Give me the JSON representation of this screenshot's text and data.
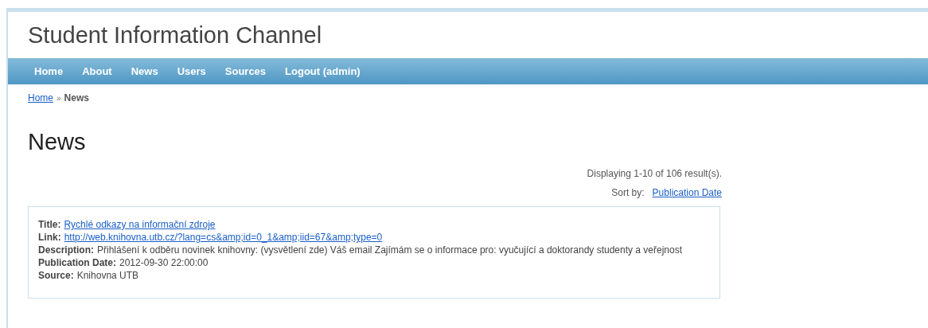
{
  "header": {
    "title": "Student Information Channel"
  },
  "nav": [
    {
      "label": "Home"
    },
    {
      "label": "About"
    },
    {
      "label": "News"
    },
    {
      "label": "Users"
    },
    {
      "label": "Sources"
    },
    {
      "label": "Logout (admin)"
    }
  ],
  "breadcrumb": {
    "link": "Home",
    "separator": "»",
    "current": "News"
  },
  "page_title": "News",
  "summary": "Displaying 1-10 of 106 result(s).",
  "sort": {
    "label": "Sort by:",
    "link": "Publication Date"
  },
  "items": [
    {
      "fields": [
        {
          "label": "Title:",
          "value": "Rychlé odkazy na informační zdroje",
          "kind": "link"
        },
        {
          "label": "Link:",
          "value": "http://web.knihovna.utb.cz/?lang=cs&amp;id=0_1&amp;iid=67&amp;type=0",
          "kind": "link"
        },
        {
          "label": "Description:",
          "value": "Přihlášení k odběru novinek knihovny: (vysvětlení zde) Váš email Zajímám se o informace pro: vyučující a doktorandy studenty a veřejnost",
          "kind": "text"
        },
        {
          "label": "Publication Date:",
          "value": "2012-09-30 22:00:00",
          "kind": "text"
        },
        {
          "label": "Source:",
          "value": "Knihovna UTB",
          "kind": "text"
        }
      ]
    }
  ]
}
